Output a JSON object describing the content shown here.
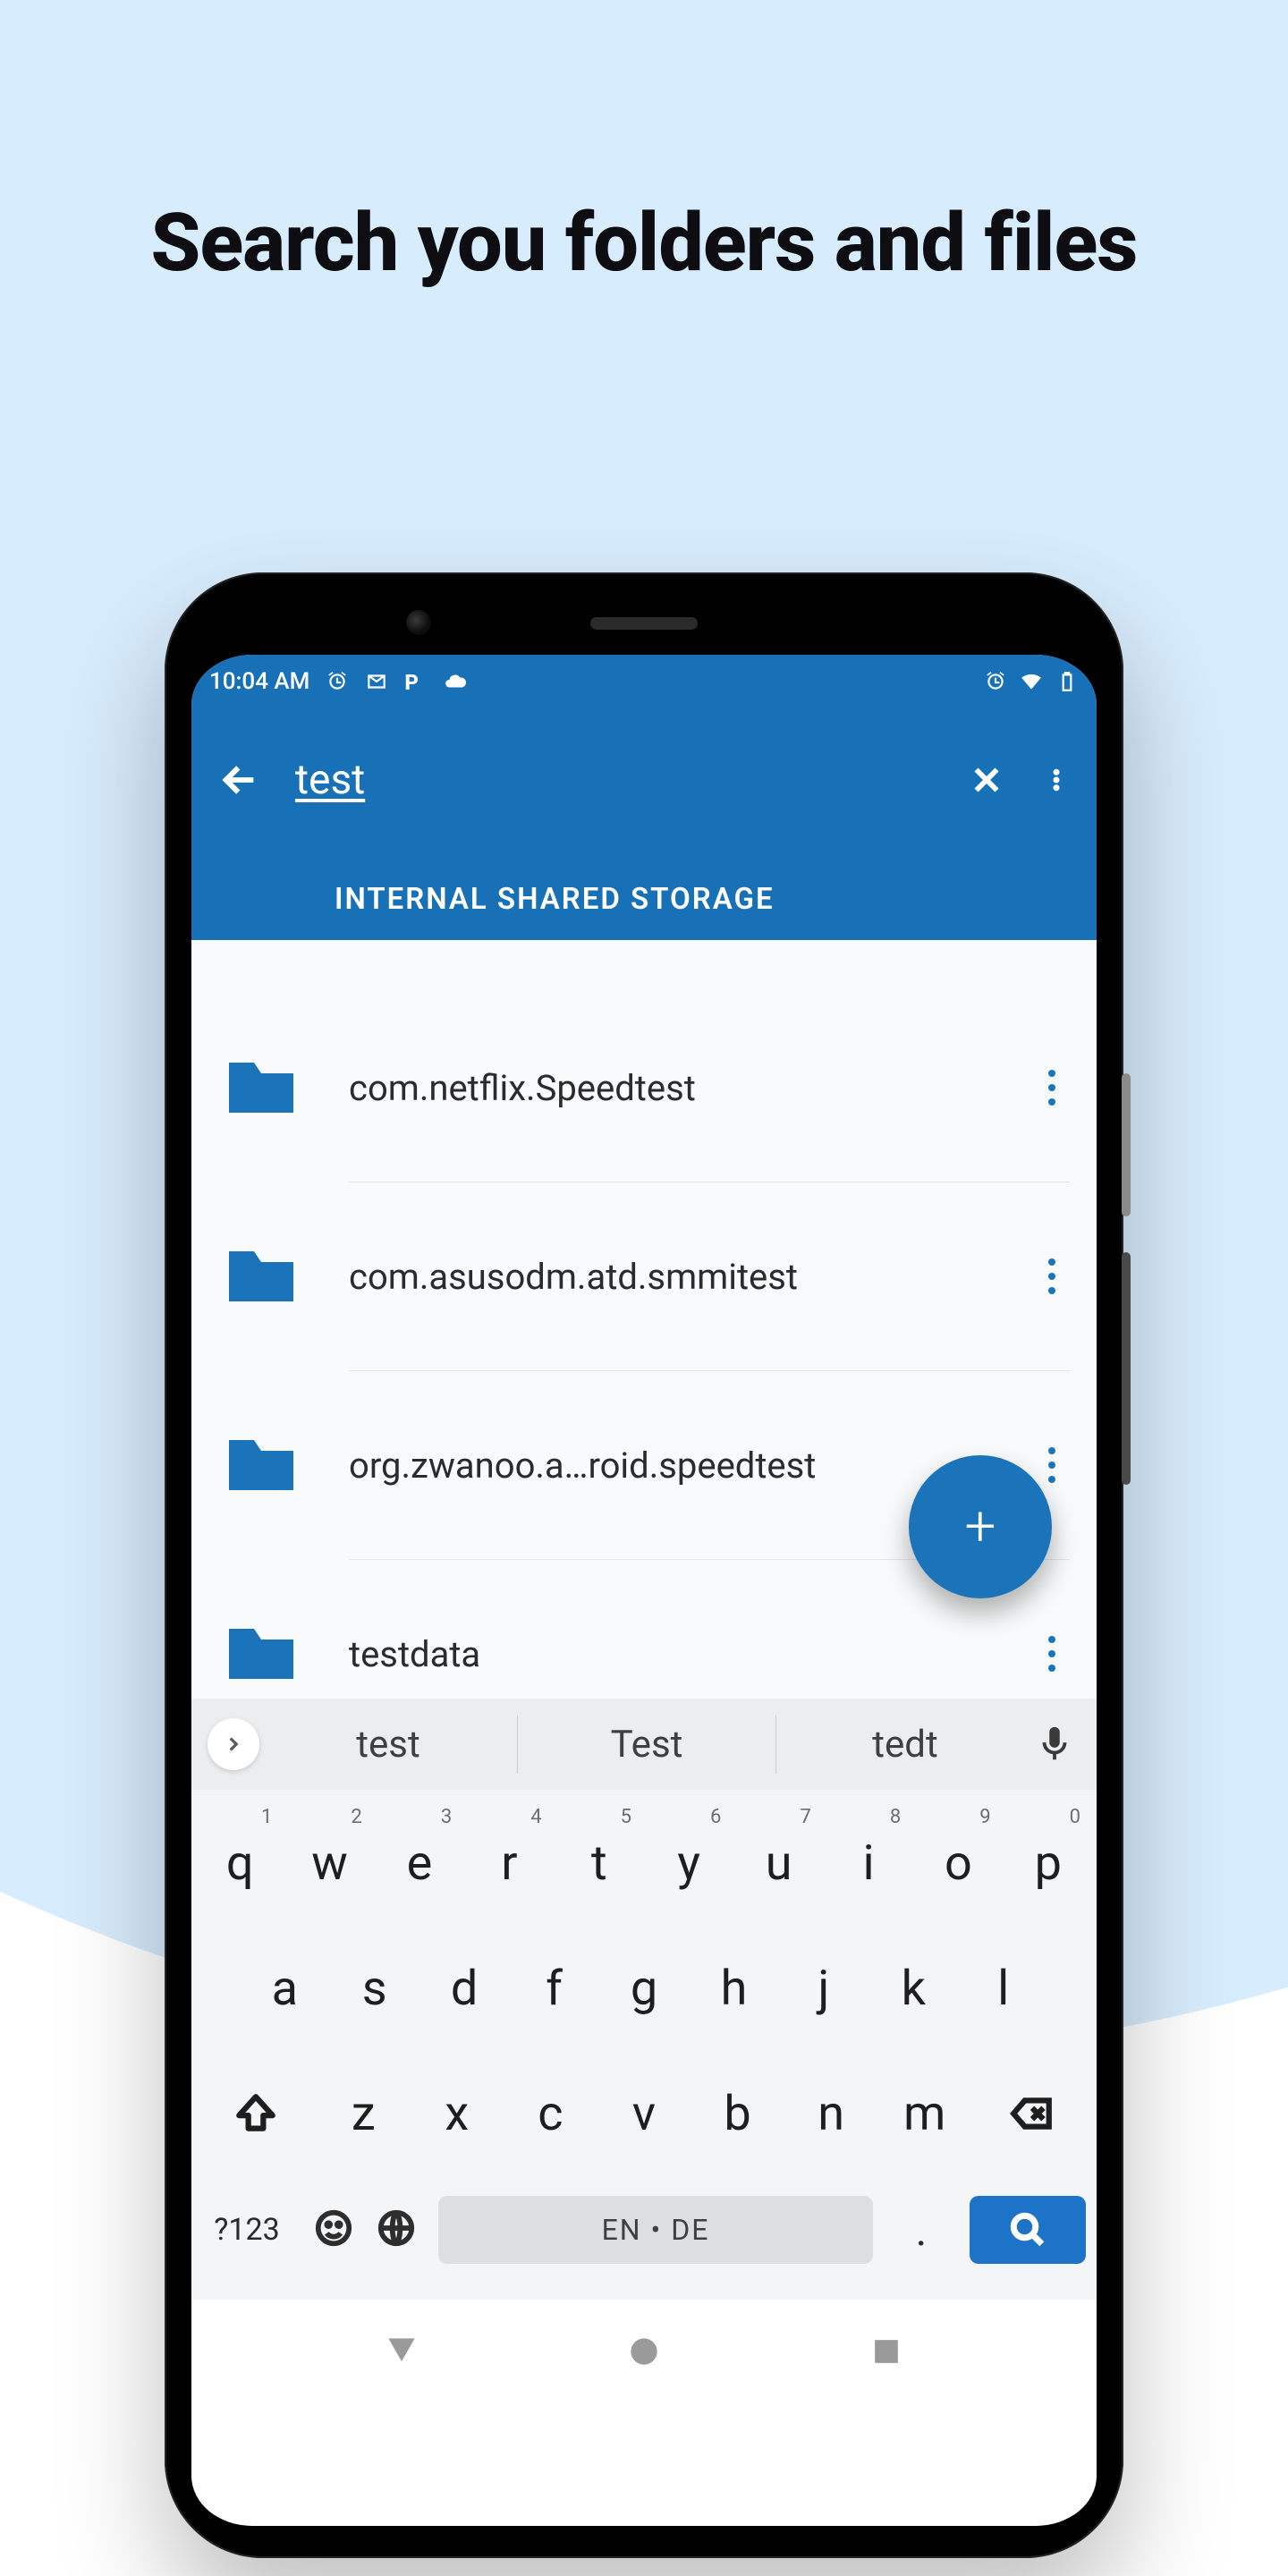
{
  "headline": "Search you folders and files",
  "statusbar": {
    "time": "10:04 AM"
  },
  "appbar": {
    "search_query": "test",
    "tab_label": "INTERNAL SHARED STORAGE"
  },
  "results": [
    {
      "name": "com.netflix.Speedtest"
    },
    {
      "name": "com.asusodm.atd.smmitest"
    },
    {
      "name": "org.zwanoo.a…roid.speedtest"
    },
    {
      "name": "testdata"
    }
  ],
  "keyboard": {
    "suggestions": [
      "test",
      "Test",
      "tedt"
    ],
    "rows": [
      [
        {
          "k": "q",
          "h": "1"
        },
        {
          "k": "w",
          "h": "2"
        },
        {
          "k": "e",
          "h": "3"
        },
        {
          "k": "r",
          "h": "4"
        },
        {
          "k": "t",
          "h": "5"
        },
        {
          "k": "y",
          "h": "6"
        },
        {
          "k": "u",
          "h": "7"
        },
        {
          "k": "i",
          "h": "8"
        },
        {
          "k": "o",
          "h": "9"
        },
        {
          "k": "p",
          "h": "0"
        }
      ],
      [
        {
          "k": "a"
        },
        {
          "k": "s"
        },
        {
          "k": "d"
        },
        {
          "k": "f"
        },
        {
          "k": "g"
        },
        {
          "k": "h"
        },
        {
          "k": "j"
        },
        {
          "k": "k"
        },
        {
          "k": "l"
        }
      ],
      [
        {
          "k": "z"
        },
        {
          "k": "x"
        },
        {
          "k": "c"
        },
        {
          "k": "v"
        },
        {
          "k": "b"
        },
        {
          "k": "n"
        },
        {
          "k": "m"
        }
      ]
    ],
    "symbols_label": "?123",
    "language_label": "EN • DE",
    "period": "."
  }
}
